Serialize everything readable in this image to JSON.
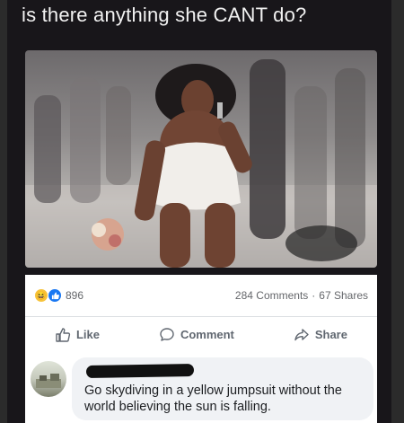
{
  "post": {
    "caption": "is there anything she CANT do?"
  },
  "stats": {
    "reaction_count": "896",
    "comments": "284 Comments",
    "separator": "·",
    "shares": "67 Shares"
  },
  "actions": {
    "like_label": "Like",
    "comment_label": "Comment",
    "share_label": "Share"
  },
  "comment": {
    "text": "Go skydiving in a yellow jumpsuit without the world believing the sun is falling."
  },
  "icons": {
    "reaction_1": "haha-reaction-icon",
    "reaction_2": "like-reaction-icon",
    "like": "thumbs-up-icon",
    "comment": "speech-bubble-icon",
    "share": "share-arrow-icon"
  },
  "colors": {
    "background": "#18161a",
    "caption_text": "#f2f2f2",
    "like_blue": "#1877f2",
    "haha_yellow": "#f7c33a",
    "muted_text": "#65676b"
  }
}
